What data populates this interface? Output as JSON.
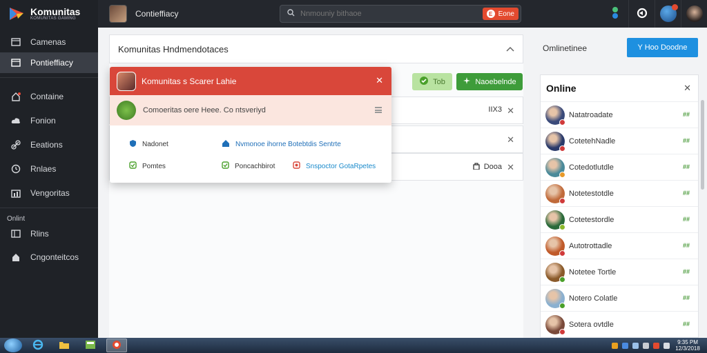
{
  "brand": {
    "name": "Komunitas",
    "sub": "KOMUNITAS GAMING"
  },
  "sidebar": {
    "items": [
      {
        "label": "Camenas",
        "icon": "window-icon"
      },
      {
        "label": "Pontieffiacy",
        "icon": "window-icon"
      },
      {
        "label": "Containe",
        "icon": "home-icon"
      },
      {
        "label": "Fonion",
        "icon": "cloud-icon"
      },
      {
        "label": "Eeations",
        "icon": "link-icon"
      },
      {
        "label": "Rnlaes",
        "icon": "clock-icon"
      },
      {
        "label": "Vengoritas",
        "icon": "chart-icon"
      }
    ],
    "section_label": "Onlint",
    "section_items": [
      {
        "label": "Rlins",
        "icon": "window-icon"
      },
      {
        "label": "Cngonteitcos",
        "icon": "home-icon"
      }
    ]
  },
  "topbar": {
    "title": "Contieffiacy",
    "search_placeholder": "Nnmouniy bithaoe",
    "search_button": "Eone",
    "search_button_badge": "E"
  },
  "main": {
    "header_title": "Komunitas Hndmendotaces",
    "btn_light_label": "Tob",
    "btn_green_label": "Naoebelnde",
    "rows": [
      {
        "meta": "IIX3"
      },
      {
        "meta": ""
      },
      {
        "meta": "Dooa"
      }
    ]
  },
  "popup": {
    "title": "Komunitas s Scarer Lahie",
    "notice": "Comoeritas oere Heee.  Co ntsveriyd",
    "links": [
      {
        "label": "Nadonet",
        "icon": "shield-icon"
      },
      {
        "label": "Nvmonoe ihorne Botebtdis  Sentrte",
        "icon": "home-icon"
      },
      {
        "label": "Pomtes",
        "icon": "check-icon"
      },
      {
        "label": "Poncachbirot",
        "icon": "check-icon"
      },
      {
        "label": "Snspoctor GotaRpetes",
        "icon": "stop-icon"
      }
    ]
  },
  "right": {
    "top_text": "Omlinetinee",
    "top_button": "Y Hoo Doodne",
    "online_title": "Online",
    "friends": [
      {
        "name": "Natatroadate",
        "badge": "##",
        "avatar": "#3a4a7a",
        "status": "#d03a3a"
      },
      {
        "name": "CotetehNadle",
        "badge": "##",
        "avatar": "#2a3a6a",
        "status": "#d03a3a"
      },
      {
        "name": "Cotedotlutdle",
        "badge": "##",
        "avatar": "#4a8a9a",
        "status": "#e89a2a"
      },
      {
        "name": "Notetestotdle",
        "badge": "##",
        "avatar": "#c06a3a",
        "status": "#d03a3a"
      },
      {
        "name": "Cotetestordle",
        "badge": "##",
        "avatar": "#2a6a3a",
        "status": "#8ab82a"
      },
      {
        "name": "Autotrottadle",
        "badge": "##",
        "avatar": "#c05a2a",
        "status": "#d03a3a"
      },
      {
        "name": "Notetee Tortle",
        "badge": "##",
        "avatar": "#8a5a2a",
        "status": "#4aa02a"
      },
      {
        "name": "Notero Colatle",
        "badge": "##",
        "avatar": "#8ab0d0",
        "status": "#4aa02a"
      },
      {
        "name": "Sotera ovtdle",
        "badge": "##",
        "avatar": "#7a4a3a",
        "status": "#d03a3a"
      }
    ]
  },
  "taskbar": {
    "clock_time": "9:35 PM",
    "clock_date": "12/3/2018"
  },
  "colors": {
    "accent_red": "#d9473a",
    "accent_blue": "#1e90e0",
    "accent_green": "#3e9c3a"
  }
}
